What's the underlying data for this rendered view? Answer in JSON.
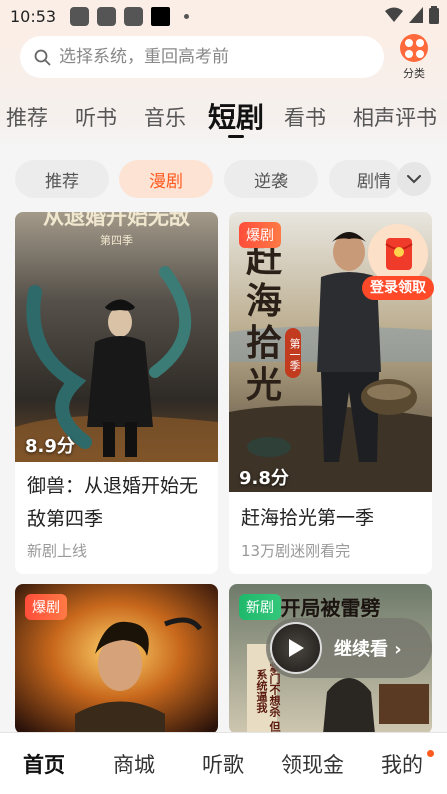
{
  "status_bar": {
    "time": "10:53"
  },
  "search": {
    "placeholder": "选择系统，重回高考前"
  },
  "category": {
    "label": "分类"
  },
  "top_tabs": [
    {
      "label": "推荐"
    },
    {
      "label": "听书"
    },
    {
      "label": "音乐"
    },
    {
      "label": "短剧",
      "active": true
    },
    {
      "label": "看书"
    },
    {
      "label": "相声评书"
    }
  ],
  "sub_tabs": [
    {
      "label": "推荐"
    },
    {
      "label": "漫剧",
      "active": true
    },
    {
      "label": "逆袭"
    },
    {
      "label": "剧情"
    }
  ],
  "cards": [
    {
      "poster_title": "从退婚开始无敌",
      "poster_season": "第四季",
      "rating": "8.9分",
      "title": "御兽：从退婚开始无敌第四季",
      "subtitle": "新剧上线"
    },
    {
      "badge": "爆剧",
      "poster_title_chars": [
        "赶",
        "海",
        "拾",
        "光"
      ],
      "poster_season": "第一季",
      "rating": "9.8分",
      "title": "赶海拾光第一季",
      "subtitle": "13万剧迷刚看完"
    },
    {
      "badge": "爆剧"
    },
    {
      "badge": "新剧",
      "poster_title": "开局被雷劈",
      "poster_banner": [
        "本掌门不想杀",
        "但系统逼我"
      ]
    }
  ],
  "login_reward": {
    "label": "登录领取"
  },
  "continue_watch": {
    "label": "继续看 ›"
  },
  "bottom_nav": [
    {
      "label": "首页",
      "active": true
    },
    {
      "label": "商城"
    },
    {
      "label": "听歌"
    },
    {
      "label": "领现金"
    },
    {
      "label": "我的",
      "has_dot": true
    }
  ],
  "colors": {
    "accent": "#ff5a1f",
    "badge_red": "#ff4d3a",
    "badge_green": "#1fb96b"
  }
}
